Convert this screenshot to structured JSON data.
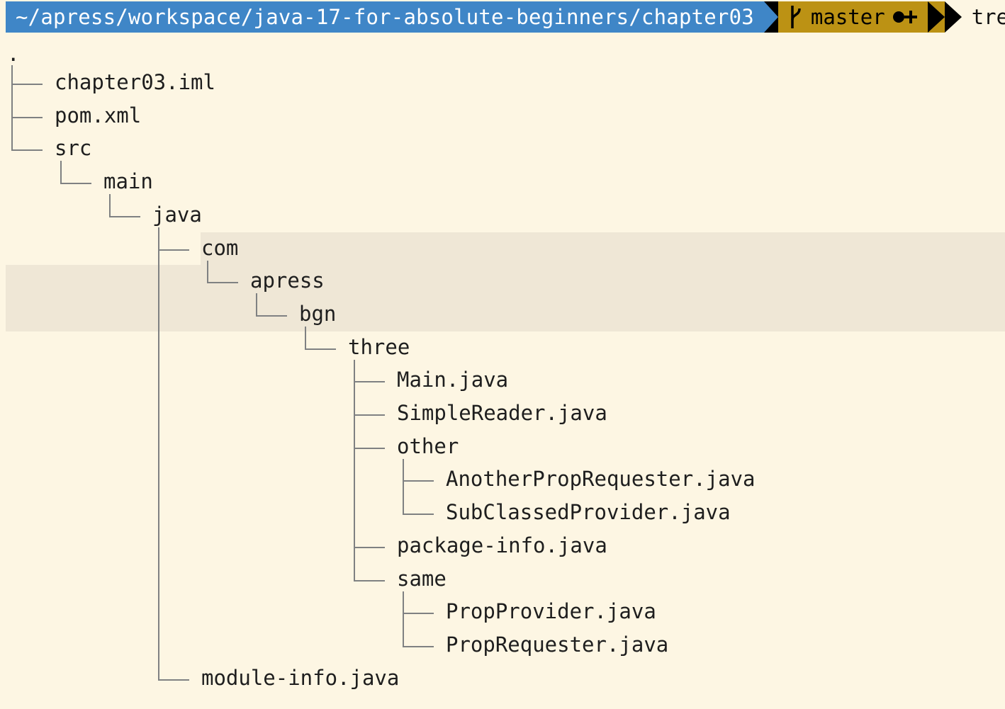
{
  "prompt": {
    "path": "~/apress/workspace/java-17-for-absolute-beginners/chapter03",
    "branch": "master",
    "command": "tree"
  },
  "tree": {
    "root": ".",
    "items": [
      "chapter03.iml",
      "pom.xml",
      "src",
      "main",
      "java",
      "com",
      "apress",
      "bgn",
      "three",
      "Main.java",
      "SimpleReader.java",
      "other",
      "AnotherPropRequester.java",
      "SubClassedProvider.java",
      "package-info.java",
      "same",
      "PropProvider.java",
      "PropRequester.java",
      "module-info.java"
    ]
  },
  "icons": {
    "branch": "git-branch-icon",
    "status": "git-dirty-status-icon"
  },
  "colors": {
    "background": "#fdf6e3",
    "path_segment": "#3f86c7",
    "git_segment": "#bc9214",
    "highlight": "#efe7d6",
    "tree_lines": "#7f8182"
  }
}
